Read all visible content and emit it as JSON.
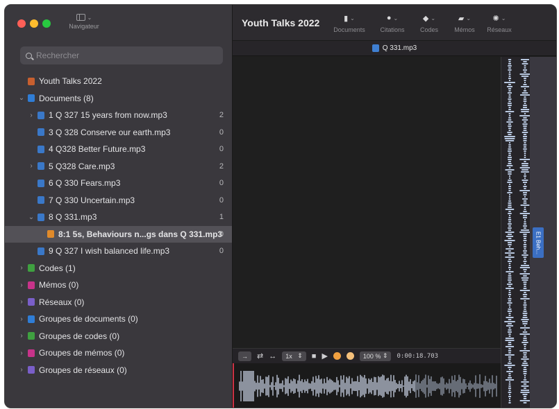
{
  "sidebar": {
    "navigator_label": "Navigateur",
    "search_placeholder": "Rechercher",
    "tree": [
      {
        "label": "Youth Talks 2022",
        "indent": 0,
        "chev": "",
        "icon": "#c75f2f",
        "count": ""
      },
      {
        "label": "Documents (8)",
        "indent": 0,
        "chev": "⌄",
        "icon": "#2f7dd6",
        "count": ""
      },
      {
        "label": "1 Q 327 15 years from now.mp3",
        "indent": 1,
        "chev": "›",
        "icon": "#3a78c8",
        "count": "2"
      },
      {
        "label": "3 Q 328 Conserve our earth.mp3",
        "indent": 1,
        "chev": "",
        "icon": "#3a78c8",
        "count": "0"
      },
      {
        "label": "4 Q328 Better Future.mp3",
        "indent": 1,
        "chev": "",
        "icon": "#3a78c8",
        "count": "0"
      },
      {
        "label": "5 Q328 Care.mp3",
        "indent": 1,
        "chev": "›",
        "icon": "#3a78c8",
        "count": "2"
      },
      {
        "label": "6 Q 330 Fears.mp3",
        "indent": 1,
        "chev": "",
        "icon": "#3a78c8",
        "count": "0"
      },
      {
        "label": "7 Q 330 Uncertain.mp3",
        "indent": 1,
        "chev": "",
        "icon": "#3a78c8",
        "count": "0"
      },
      {
        "label": "8 Q 331.mp3",
        "indent": 1,
        "chev": "⌄",
        "icon": "#3a78c8",
        "count": "1"
      },
      {
        "label": "8:1 5s, Behaviours n...gs dans Q 331.mp3",
        "indent": 2,
        "chev": "",
        "icon": "#e08a2a",
        "count": "0",
        "selected": true,
        "bold": true
      },
      {
        "label": "9 Q 327 I wish balanced life.mp3",
        "indent": 1,
        "chev": "",
        "icon": "#3a78c8",
        "count": "0"
      },
      {
        "label": "Codes (1)",
        "indent": 0,
        "chev": "›",
        "icon": "#3fa040",
        "count": ""
      },
      {
        "label": "Mémos (0)",
        "indent": 0,
        "chev": "›",
        "icon": "#c7338a",
        "count": ""
      },
      {
        "label": "Réseaux (0)",
        "indent": 0,
        "chev": "›",
        "icon": "#7a5fc9",
        "count": ""
      },
      {
        "label": "Groupes de documents (0)",
        "indent": 0,
        "chev": "›",
        "icon": "#2f7dd6",
        "count": ""
      },
      {
        "label": "Groupes de codes (0)",
        "indent": 0,
        "chev": "›",
        "icon": "#3fa040",
        "count": ""
      },
      {
        "label": "Groupes de mémos (0)",
        "indent": 0,
        "chev": "›",
        "icon": "#c7338a",
        "count": ""
      },
      {
        "label": "Groupes de réseaux (0)",
        "indent": 0,
        "chev": "›",
        "icon": "#7a5fc9",
        "count": ""
      }
    ]
  },
  "toolbar": {
    "title": "Youth Talks 2022",
    "buttons": [
      {
        "label": "Documents",
        "glyph": "▮"
      },
      {
        "label": "Citations",
        "glyph": "●"
      },
      {
        "label": "Codes",
        "glyph": "◆"
      },
      {
        "label": "Mémos",
        "glyph": "▰"
      },
      {
        "label": "Réseaux",
        "glyph": "✺"
      }
    ]
  },
  "tab": {
    "label": "Q 331.mp3"
  },
  "code_tag": "E1 Beh...",
  "player": {
    "speed": "1x",
    "zoom": "100 %",
    "time": "0:00:18.703"
  },
  "colors": {
    "accent": "#3b6fc3",
    "playhead": "#cc3344"
  }
}
